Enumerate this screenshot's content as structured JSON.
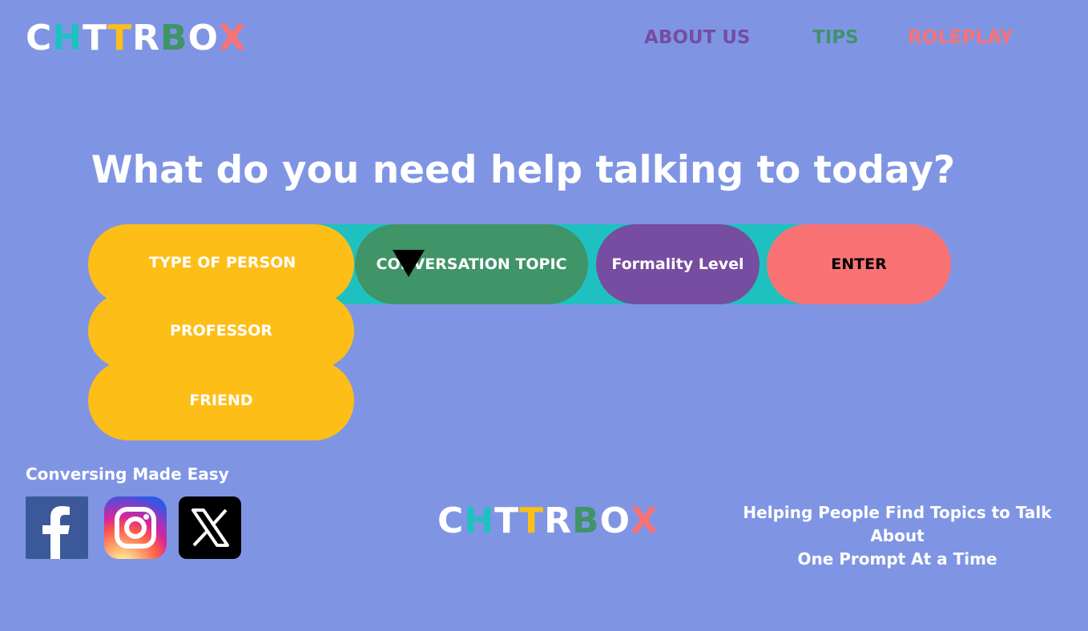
{
  "brand": {
    "letters": [
      {
        "char": "C",
        "color": "#ffffff"
      },
      {
        "char": "H",
        "color": "#1fc1c0"
      },
      {
        "char": "T",
        "color": "#ffffff"
      },
      {
        "char": "T",
        "color": "#fdbe18"
      },
      {
        "char": "R",
        "color": "#ffffff"
      },
      {
        "char": "B",
        "color": "#3f9468"
      },
      {
        "char": "O",
        "color": "#ffffff"
      },
      {
        "char": "X",
        "color": "#f97274"
      }
    ]
  },
  "nav": {
    "about": {
      "label": "ABOUT US",
      "color": "#764da0"
    },
    "tips": {
      "label": "TIPS",
      "color": "#3f9468"
    },
    "roleplay": {
      "label": "ROLEPLAY",
      "color": "#f97274"
    }
  },
  "main": {
    "headline": "What do you need help talking to today?",
    "person_dropdown": {
      "label": "TYPE OF PERSON",
      "options": [
        "PROFESSOR",
        "FRIEND"
      ]
    },
    "topic_label": "CONVERSATION TOPIC",
    "formality_label": "Formality Level",
    "enter_label": "ENTER"
  },
  "footer": {
    "tagline": "Conversing Made Easy",
    "social_icons": [
      "facebook-icon",
      "instagram-icon",
      "x-icon"
    ],
    "blurb_line1": "Helping People Find Topics to Talk About",
    "blurb_line2": "One Prompt At a Time"
  },
  "colors": {
    "background": "#7f95e4",
    "yellow": "#fdbe18",
    "teal": "#1fc1c0",
    "green": "#3f9468",
    "purple": "#764da0",
    "coral": "#f97274"
  }
}
